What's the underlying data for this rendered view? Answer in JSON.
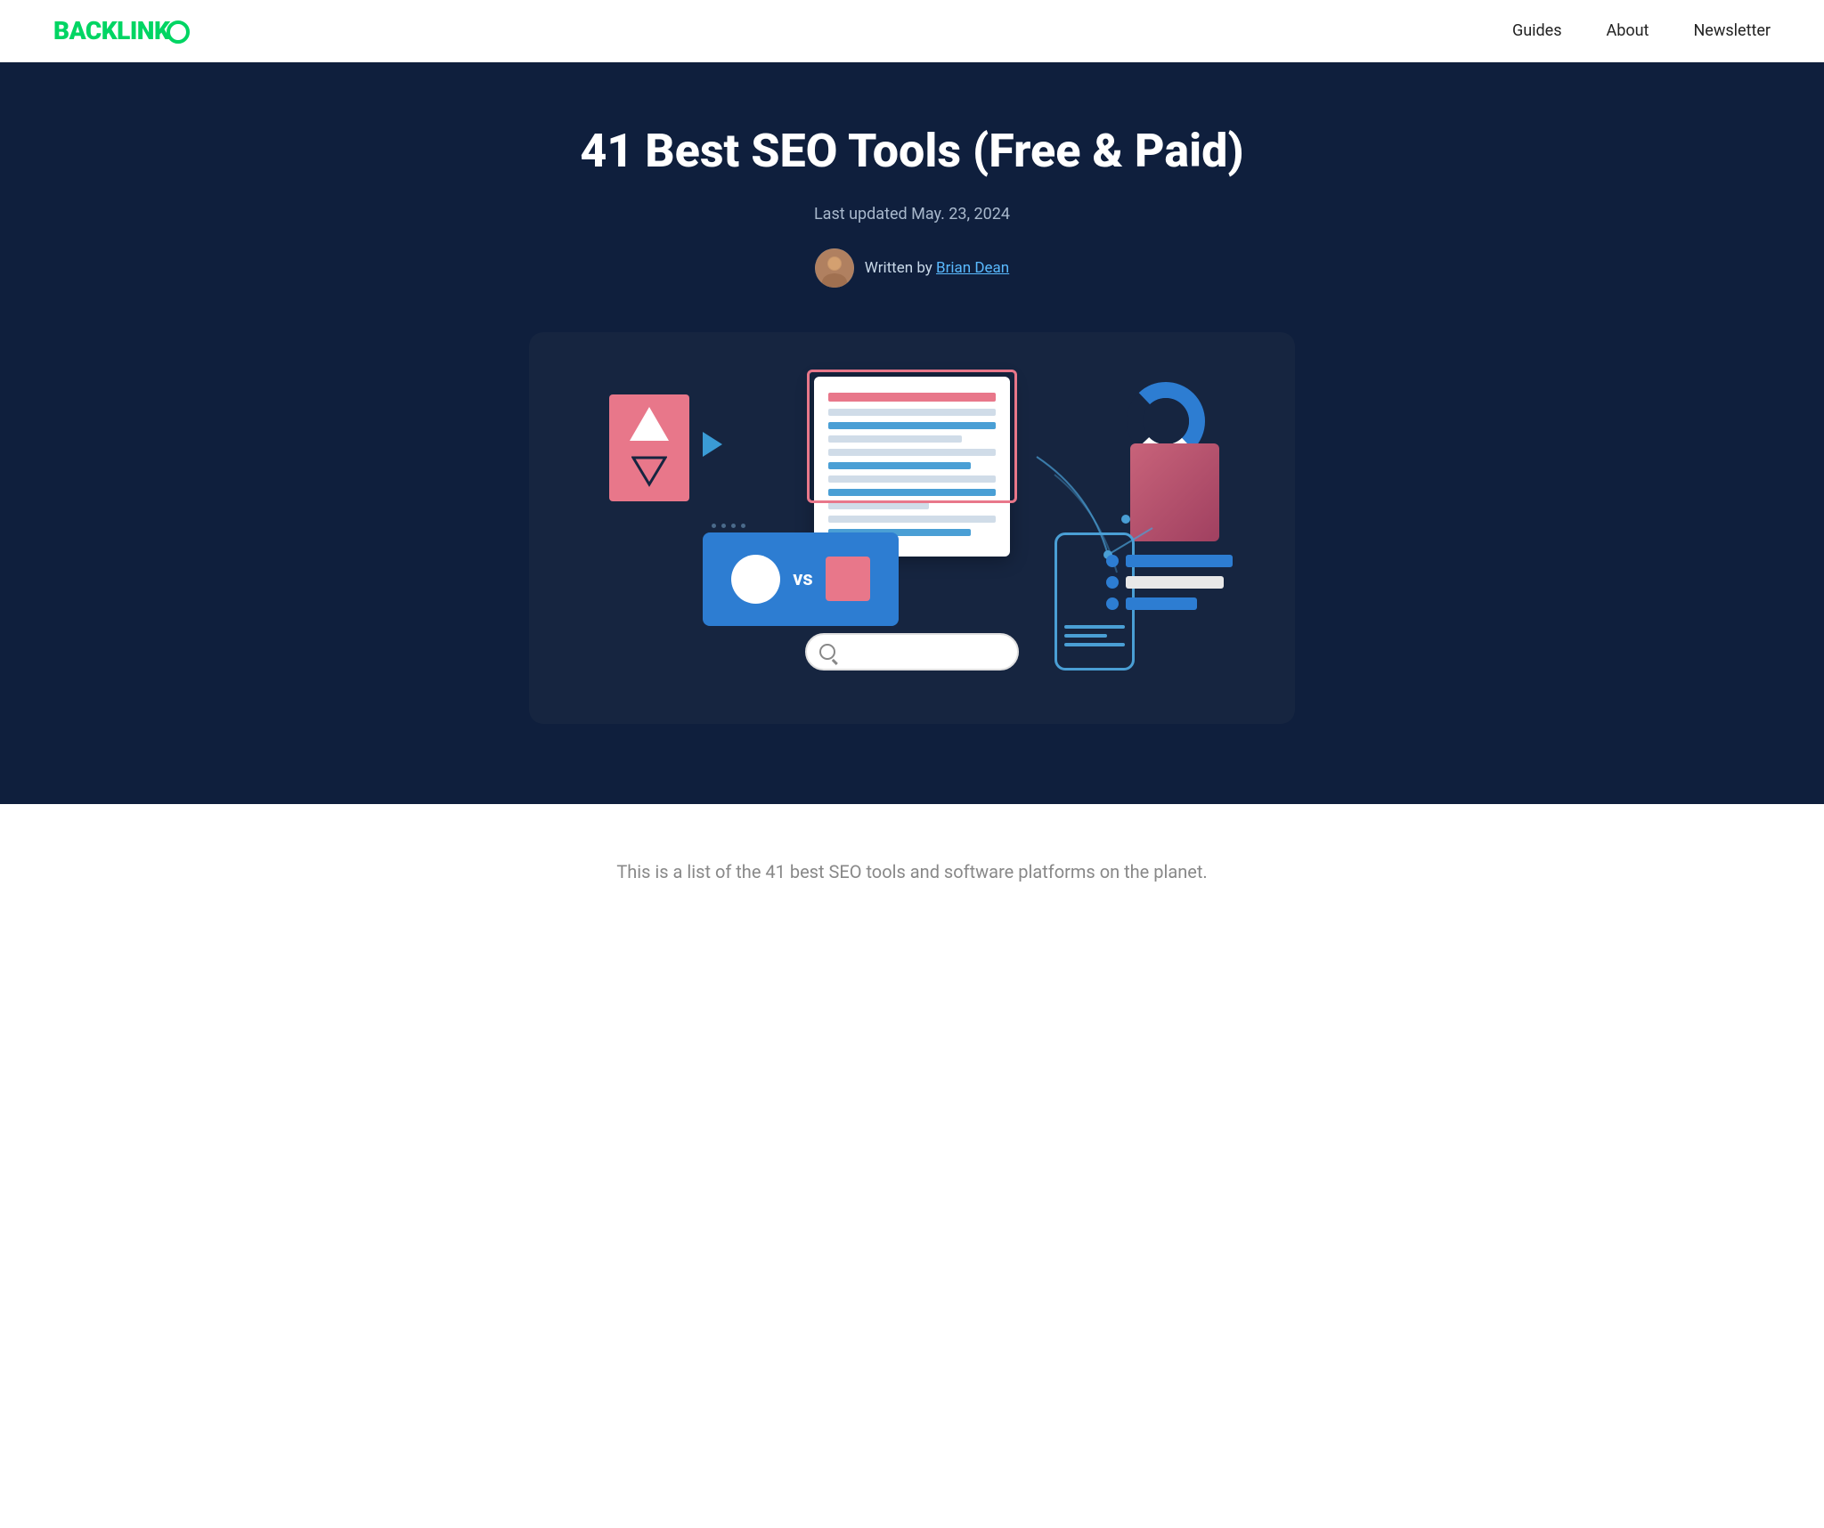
{
  "header": {
    "logo_text": "BACKLINK",
    "logo_o": "O",
    "nav": {
      "guides": "Guides",
      "about": "About",
      "newsletter": "Newsletter"
    }
  },
  "hero": {
    "title": "41 Best SEO Tools (Free & Paid)",
    "updated": "Last updated May. 23, 2024",
    "written_by": "Written by",
    "author_name": "Brian Dean",
    "illustration_alt": "SEO tools illustration"
  },
  "content": {
    "intro": "This is a list of the 41 best SEO tools and software platforms on the planet."
  },
  "colors": {
    "logo_green": "#00d563",
    "hero_bg": "#0f1f3d",
    "accent_blue": "#2d7dd2",
    "accent_pink": "#e8778a"
  }
}
